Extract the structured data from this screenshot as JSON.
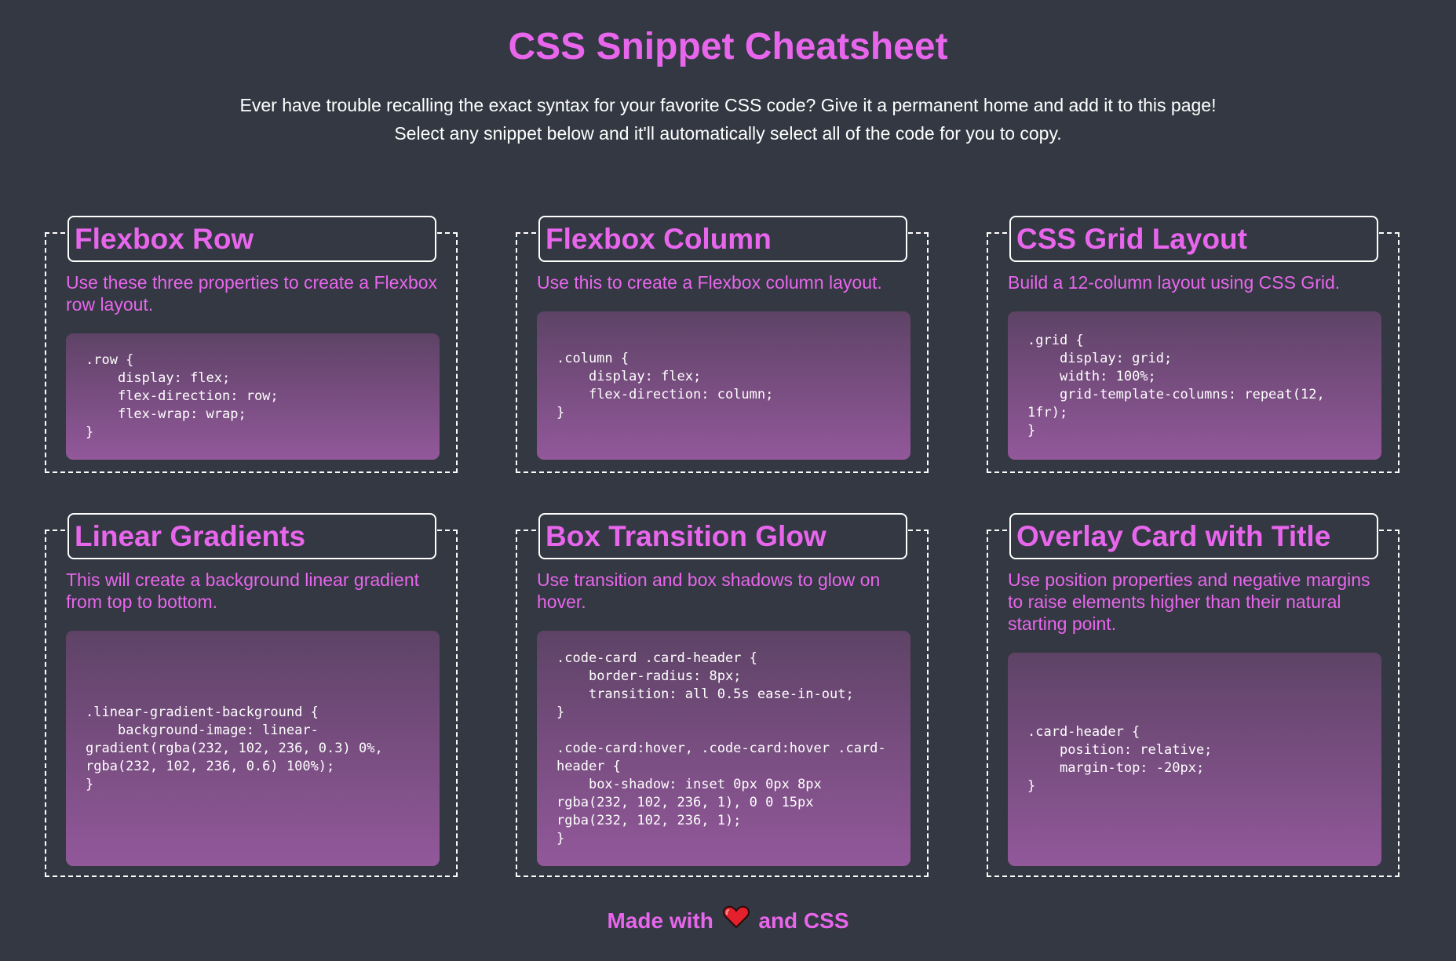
{
  "header": {
    "title": "CSS Snippet Cheatsheet",
    "intro_line1": "Ever have trouble recalling the exact syntax for your favorite CSS code? Give it a permanent home and add it to this page!",
    "intro_line2": "Select any snippet below and it'll automatically select all of the code for you to copy."
  },
  "cards": [
    {
      "title": "Flexbox Row",
      "description": "Use these three properties to create a Flexbox row layout.",
      "code": ".row {\n    display: flex;\n    flex-direction: row;\n    flex-wrap: wrap;\n}"
    },
    {
      "title": "Flexbox Column",
      "description": "Use this to create a Flexbox column layout.",
      "code": ".column {\n    display: flex;\n    flex-direction: column;\n}"
    },
    {
      "title": "CSS Grid Layout",
      "description": "Build a 12-column layout using CSS Grid.",
      "code": ".grid {\n    display: grid;\n    width: 100%;\n    grid-template-columns: repeat(12, 1fr);\n}"
    },
    {
      "title": "Linear Gradients",
      "description": "This will create a background linear gradient from top to bottom.",
      "code": ".linear-gradient-background {\n    background-image: linear-gradient(rgba(232, 102, 236, 0.3) 0%, rgba(232, 102, 236, 0.6) 100%);\n}"
    },
    {
      "title": "Box Transition Glow",
      "description": "Use transition and box shadows to glow on hover.",
      "code": ".code-card .card-header {\n    border-radius: 8px;\n    transition: all 0.5s ease-in-out;\n}\n\n.code-card:hover, .code-card:hover .card-header {\n    box-shadow: inset 0px 0px 8px rgba(232, 102, 236, 1), 0 0 15px rgba(232, 102, 236, 1);\n}"
    },
    {
      "title": "Overlay Card with Title",
      "description": "Use position properties and negative margins to raise elements higher than their natural starting point.",
      "code": ".card-header {\n    position: relative;\n    margin-top: -20px;\n}"
    }
  ],
  "footer": {
    "made_with": "Made with",
    "heart_icon": "heart-icon",
    "and_css": "and CSS"
  },
  "colors": {
    "background": "#333842",
    "accent": "#e866ec",
    "code_gradient_top": "#5e4366",
    "code_gradient_bottom": "#92589a"
  }
}
